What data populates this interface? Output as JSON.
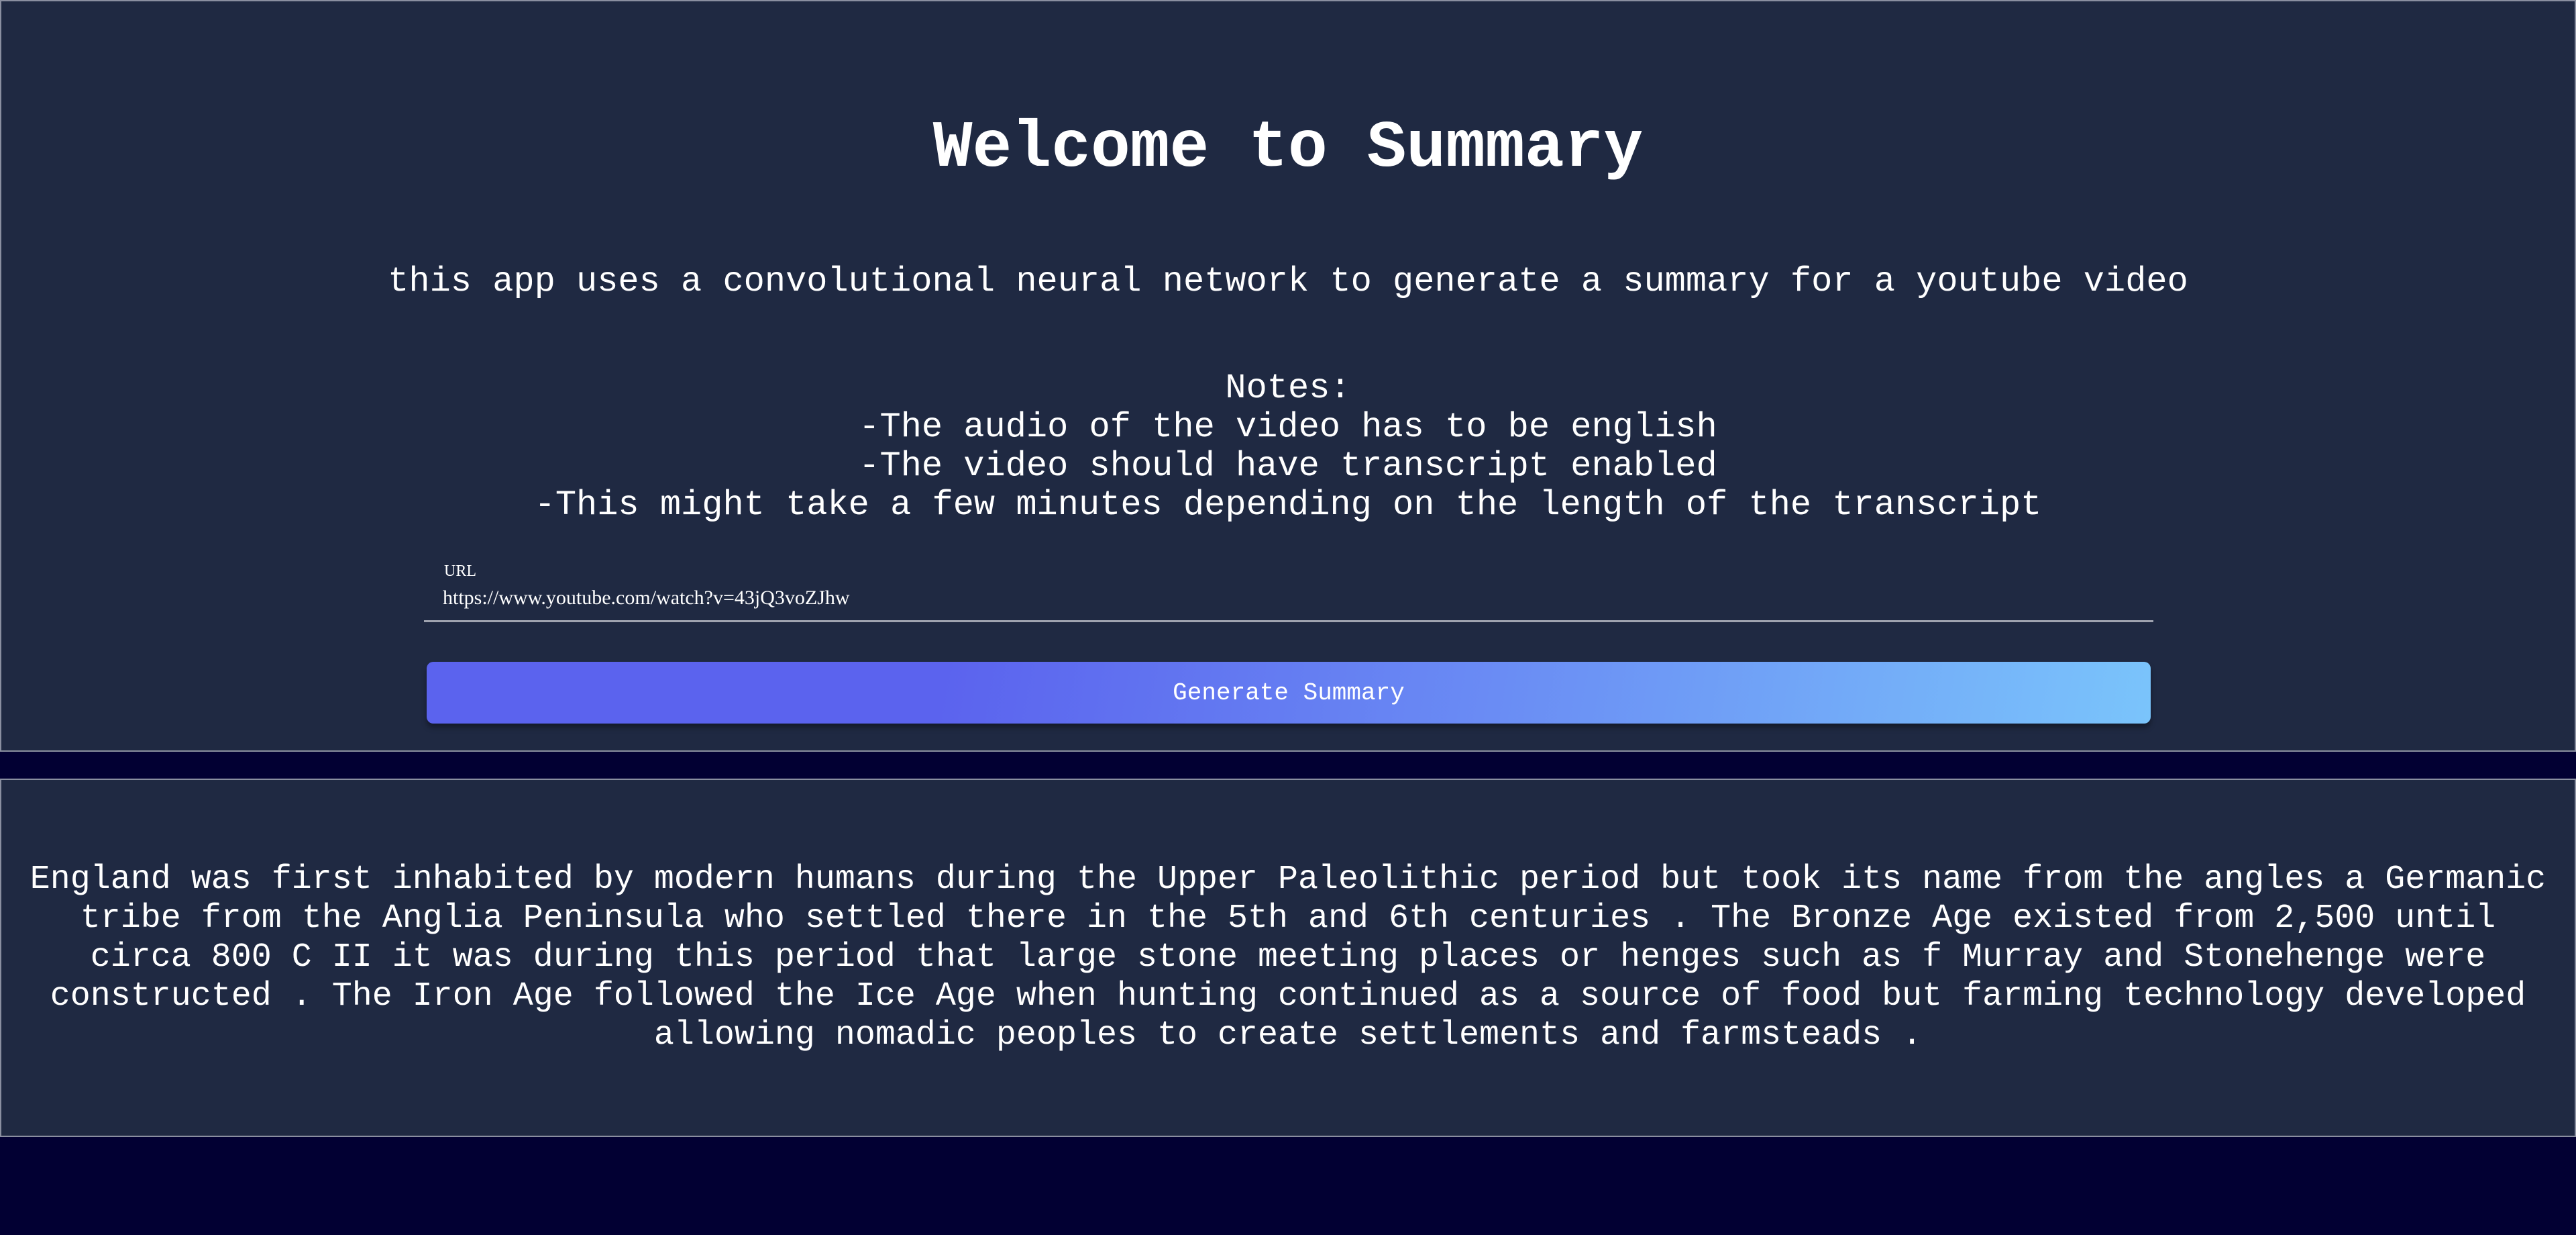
{
  "header": {
    "title": "Welcome to Summary",
    "description": "this app uses a convolutional neural network to generate a summary for a youtube video"
  },
  "notes": {
    "heading": "Notes:",
    "items": [
      "-The audio of the video has to be english",
      "-The video should have transcript enabled",
      "-This might take a few minutes depending on the length of the transcript"
    ]
  },
  "form": {
    "url_label": "URL",
    "url_value": "https://www.youtube.com/watch?v=43jQ3voZJhw",
    "button_label": "Generate Summary"
  },
  "result": {
    "summary": "England was first inhabited by modern humans during the Upper Paleolithic period but took its name from the angles a Germanic tribe from the Anglia Peninsula who settled there in the 5th and 6th centuries . The Bronze Age existed from 2,500 until circa 800 C II it was during this period that large stone meeting places or henges such as f Murray and Stonehenge were constructed . The Iron Age followed the Ice Age when hunting continued as a source of food but farming technology developed allowing nomadic peoples to create settlements and farmsteads ."
  },
  "colors": {
    "page_background": "#020033",
    "panel_background": "#1f2942",
    "button_gradient_start": "#5b63ee",
    "button_gradient_end": "#7ac4fb"
  }
}
